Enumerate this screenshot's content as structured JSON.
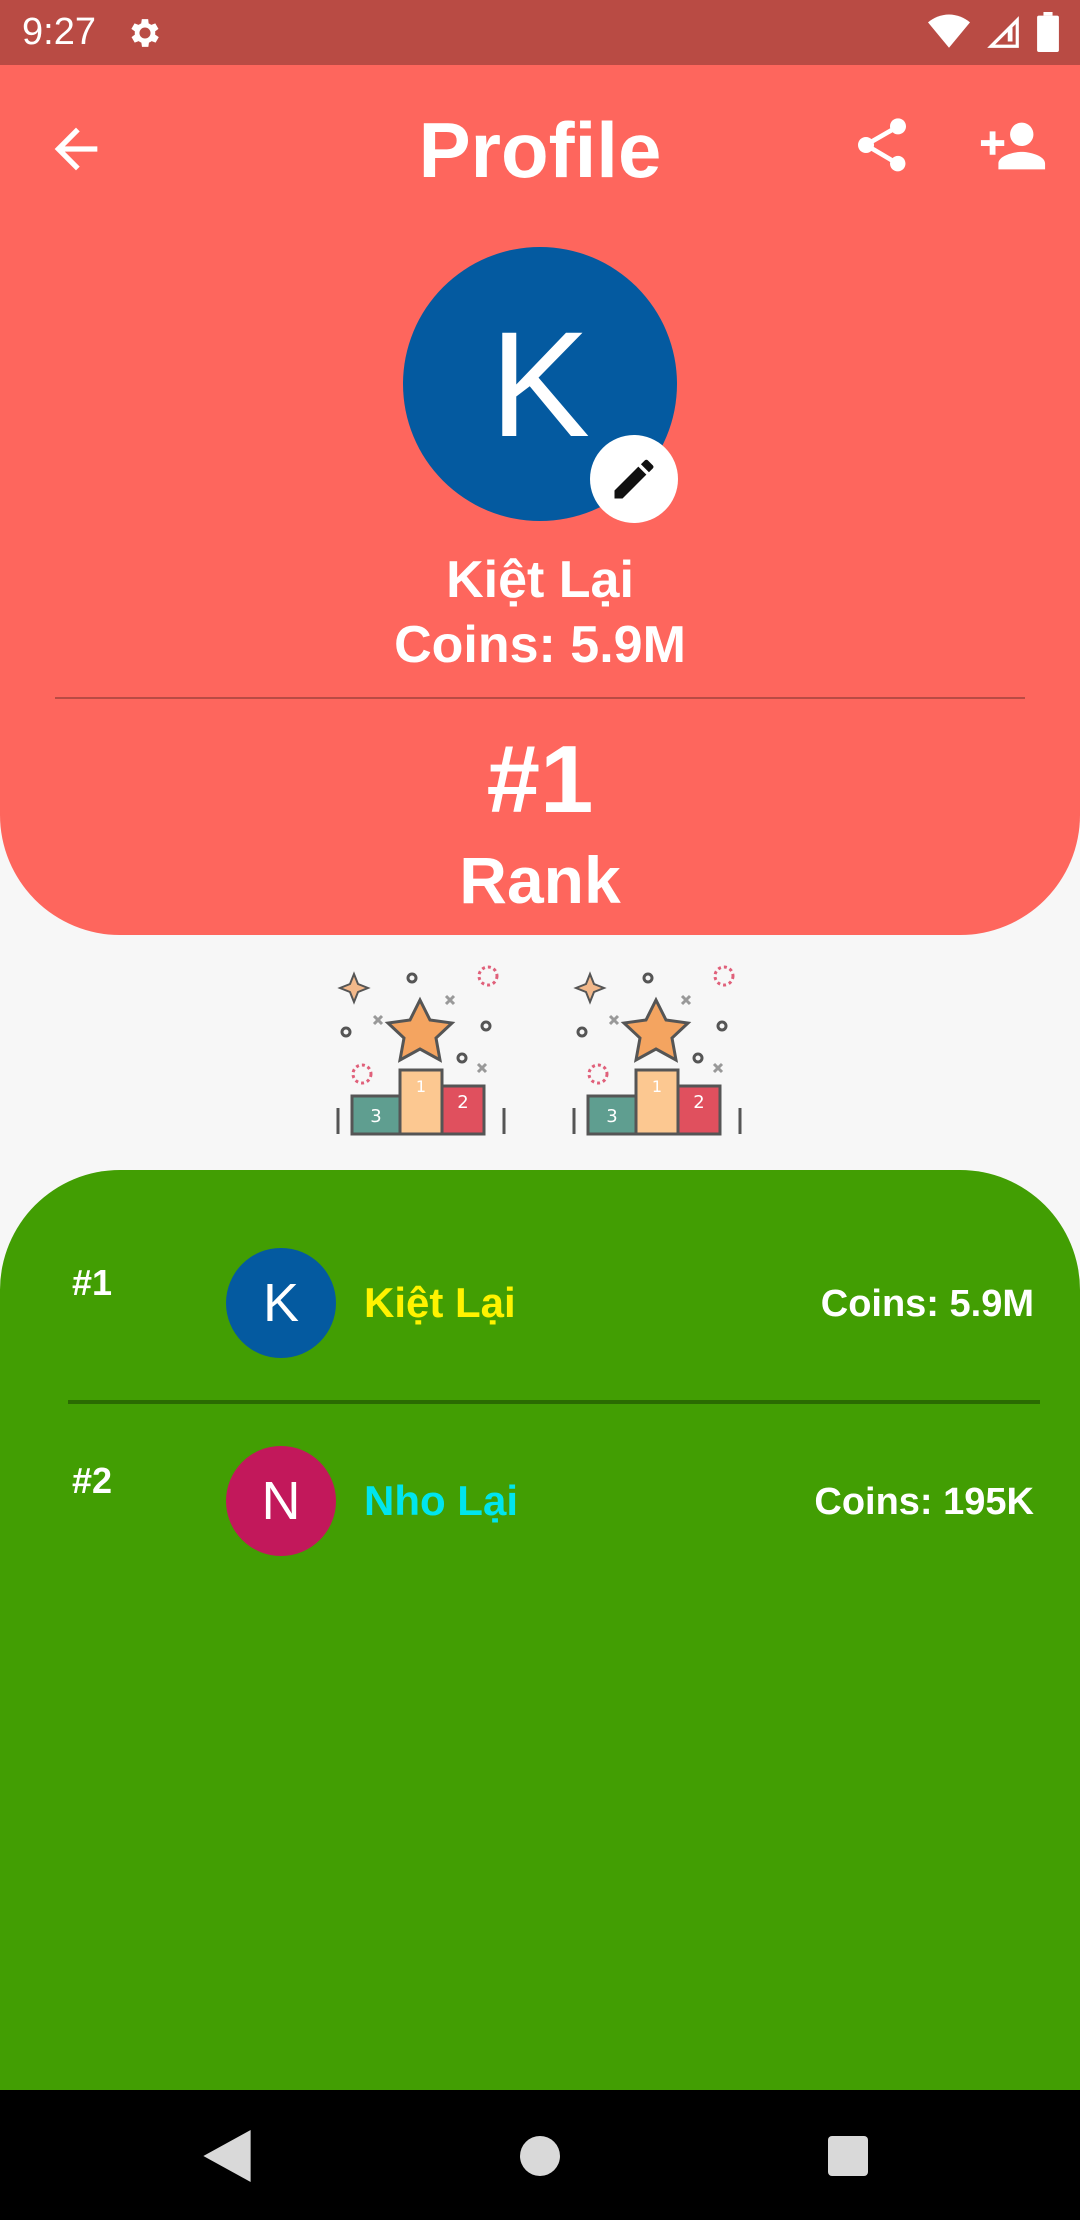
{
  "status_bar": {
    "time": "9:27",
    "icons": [
      "settings-gear",
      "wifi",
      "cellular-signal",
      "battery"
    ]
  },
  "header": {
    "title": "Profile",
    "back_icon": "arrow-left",
    "share_icon": "share",
    "add_person_icon": "person-add",
    "color": "#fe665d"
  },
  "profile": {
    "avatar_initial": "K",
    "avatar_color": "#045aa0",
    "edit_icon": "pencil",
    "name": "Kiệt Lại",
    "coins": "Coins: 5.9M",
    "rank": "#1",
    "rank_label": "Rank"
  },
  "illustrations": [
    "podium-star",
    "podium-star"
  ],
  "leaderboard": {
    "color": "#429e03",
    "rows": [
      {
        "rank": "#1",
        "initial": "K",
        "avatar_color": "#045aa0",
        "name": "Kiệt Lại",
        "name_color": "#fff300",
        "coins": "Coins: 5.9M"
      },
      {
        "rank": "#2",
        "initial": "N",
        "avatar_color": "#c2185b",
        "name": "Nho Lại",
        "name_color": "#00e5ee",
        "coins": "Coins: 195K"
      }
    ]
  },
  "nav_bar": {
    "icons": [
      "back-triangle",
      "home-circle",
      "recents-square"
    ]
  }
}
